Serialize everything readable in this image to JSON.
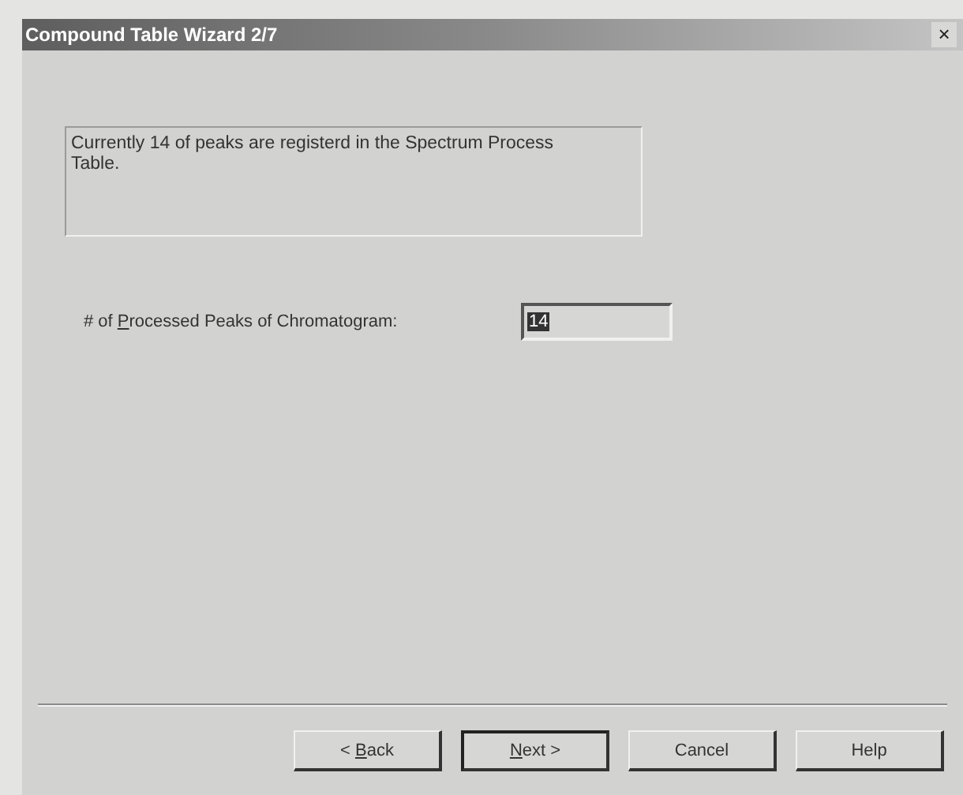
{
  "window": {
    "title": "Compound Table Wizard 2/7",
    "close": "×"
  },
  "info_text": "Currently 14 of peaks are registerd in the Spectrum Process Table.",
  "field": {
    "label": {
      "before": "# of ",
      "access_key": "P",
      "after": "rocessed Peaks of Chromatogram:"
    },
    "value": "14",
    "value_selected": true
  },
  "buttons": [
    {
      "label": {
        "before": "< ",
        "access_key": "B",
        "after": "ack"
      },
      "default": false
    },
    {
      "label": {
        "access_key": "N",
        "after": "ext >"
      },
      "default": true
    },
    {
      "label": {
        "before": "Cancel"
      },
      "default": false
    },
    {
      "label": {
        "before": "Help"
      },
      "default": false
    }
  ]
}
